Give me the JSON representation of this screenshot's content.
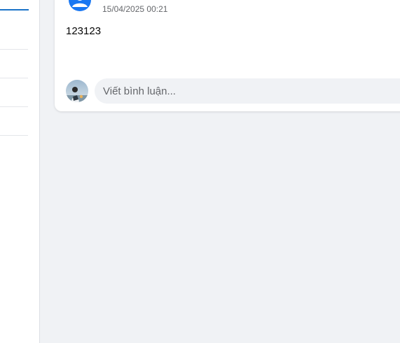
{
  "post": {
    "timestamp": "15/04/2025 00:21",
    "content": "123123",
    "author_icon": "user-icon"
  },
  "comment": {
    "placeholder": "Viết bình luận..."
  },
  "colors": {
    "accent": "#1a73c8",
    "avatar_blue": "#1877f2",
    "background": "#f0f2f5",
    "muted_text": "#65676b"
  }
}
